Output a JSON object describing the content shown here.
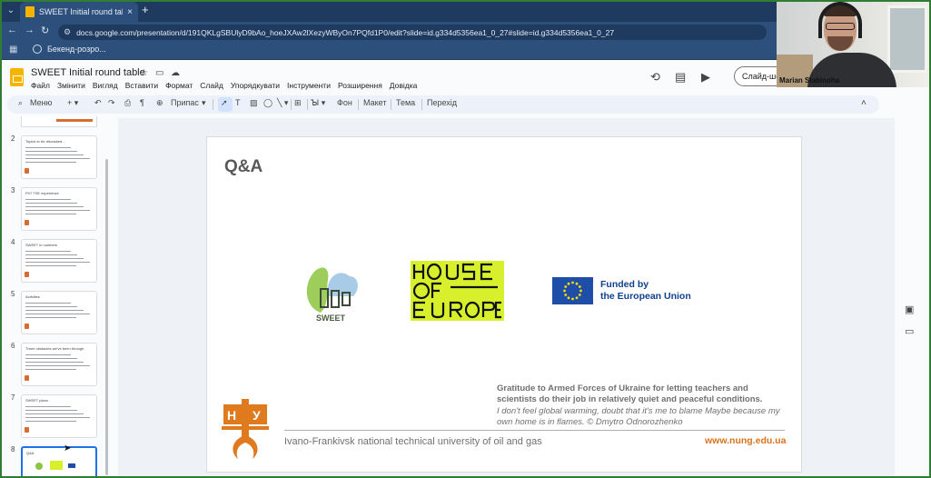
{
  "browser": {
    "tab_title": "SWEET Initial round table",
    "tab_close": "×",
    "new_tab": "+",
    "url": "docs.google.com/presentation/d/191QKLgSBUlyD9bAo_hoeJXAw2lXezyWByOn7PQfd1P0/edit?slide=id.g334d5356ea1_0_27#slide=id.g334d5356ea1_0_27",
    "bookmark": "Бекенд-розро..."
  },
  "docs": {
    "title": "SWEET Initial round table",
    "menu": [
      "Файл",
      "Змінити",
      "Вигляд",
      "Вставити",
      "Формат",
      "Слайд",
      "Упорядкувати",
      "Інструменти",
      "Розширення",
      "Довідка"
    ],
    "slideshow_button": "Слайд-шоу"
  },
  "toolbar": {
    "menu_label": "Меню",
    "zoom_label": "Припас",
    "background": "Фон",
    "layout": "Макет",
    "theme": "Тема",
    "transition": "Перехід"
  },
  "filmstrip": {
    "slides": [
      {
        "num": "2",
        "title": "Topics to be discussed..."
      },
      {
        "num": "3",
        "title": "PhT TSE experience"
      },
      {
        "num": "4",
        "title": "SWEET in numbers"
      },
      {
        "num": "5",
        "title": "Activities"
      },
      {
        "num": "6",
        "title": "Three obstacles we've been through"
      },
      {
        "num": "7",
        "title": "SWEET plans"
      },
      {
        "num": "8",
        "title": "Q&A"
      }
    ],
    "selected": "8"
  },
  "slide": {
    "title": "Q&A",
    "sweet_label": "SWEET",
    "eu_line1": "Funded by",
    "eu_line2": "the European Union",
    "hoe_text": "HOUSE OF EUROPE",
    "gratitude": "Gratitude to Armed Forces of Ukraine for letting teachers and scientists do their job in relatively quiet and peaceful conditions.",
    "quote": "I don't feel global warming, doubt that it's me to blame Maybe because my own home is in flames. © Dmytro Odnorozhenko",
    "university": "Ivano-Frankivsk national technical university of oil and gas",
    "website": "www.nung.edu.ua"
  },
  "webcam": {
    "name": "Marian Slabinoha"
  },
  "colors": {
    "browser_chrome": "#2c4f7c",
    "selection_blue": "#1a73e8",
    "accent_orange": "#d8731d",
    "hoe_green": "#d7f02b",
    "eu_blue": "#1f4ea8"
  }
}
